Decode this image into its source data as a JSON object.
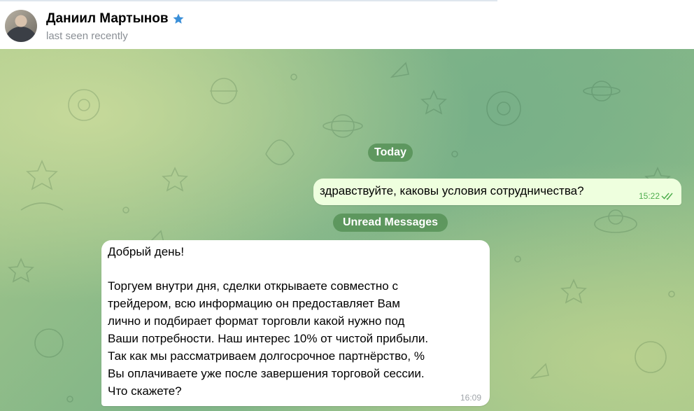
{
  "header": {
    "name": "Даниил Мартынов",
    "status": "last seen recently"
  },
  "chat": {
    "date_label": "Today",
    "unread_label": "Unread Messages",
    "outgoing": {
      "text": "здравствуйте, каковы условия сотрудничества?",
      "time": "15:22"
    },
    "incoming": {
      "lines": [
        "Добрый день!",
        "",
        "Торгуем внутри дня, сделки открываете совместно с",
        "трейдером, всю информацию он предоставляет Вам",
        "лично и подбирает формат торговли какой нужно под",
        "Ваши потребности.  Наш интерес 10% от чистой прибыли.",
        "Так как мы рассматриваем долгосрочное партнёрство, %",
        "Вы оплачиваете уже после завершения торговой сессии.",
        "Что скажете?"
      ],
      "time": "16:09"
    }
  },
  "colors": {
    "outgoing_bubble": "#eeffde",
    "incoming_bubble": "#ffffff",
    "read_check": "#4fae4e",
    "verified_star": "#3a8fd8"
  },
  "icons": {
    "verified": "verified-star-icon",
    "read_status": "double-check-icon"
  }
}
